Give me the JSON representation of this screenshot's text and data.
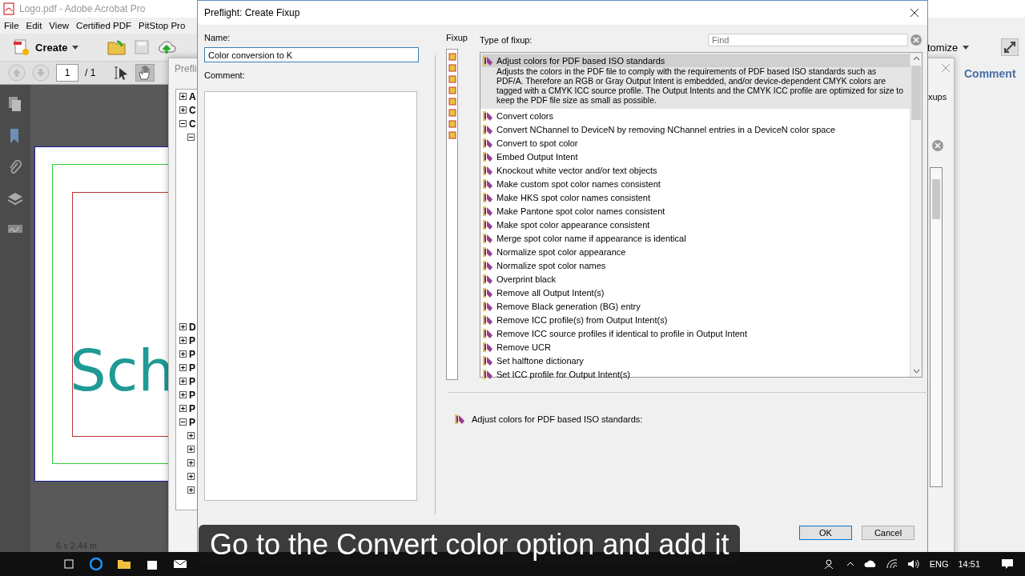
{
  "acrobat": {
    "title": "Logo.pdf - Adobe Acrobat Pro",
    "menu": [
      "File",
      "Edit",
      "View",
      "Certified PDF",
      "PitStop Pro"
    ],
    "create_button": "Create",
    "page_number": "1",
    "page_count": "/ 1",
    "document_text": "Sch",
    "customize_button": "tomize",
    "comment_tab": "Comment",
    "page_size": "6 x 2.44 in"
  },
  "preflight_window": {
    "title": "Prefli",
    "side_text": "xups",
    "tree": [
      {
        "label": "A",
        "expanded": false
      },
      {
        "label": "C",
        "expanded": false
      },
      {
        "label": "C",
        "expanded": true,
        "children": [
          {
            "expanded": true
          }
        ]
      },
      {
        "label": "D",
        "expanded": false
      },
      {
        "label": "P",
        "expanded": false
      },
      {
        "label": "P",
        "expanded": false
      },
      {
        "label": "P",
        "expanded": false
      },
      {
        "label": "P",
        "expanded": false
      },
      {
        "label": "P",
        "expanded": false
      },
      {
        "label": "P",
        "expanded": false
      },
      {
        "label": "P",
        "expanded": true,
        "children": [
          {
            "expanded": false
          },
          {
            "expanded": false
          },
          {
            "expanded": false
          },
          {
            "expanded": false
          },
          {
            "expanded": false
          }
        ]
      }
    ]
  },
  "dialog": {
    "title": "Preflight: Create Fixup",
    "name_label": "Name:",
    "name_value": "Color conversion to K",
    "comment_label": "Comment:",
    "fixup_label": "Fixup",
    "type_label": "Type of fixup:",
    "find_placeholder": "Find",
    "fixup_types": [
      {
        "label": "Adjust colors for PDF based ISO standards",
        "selected": true,
        "description": "Adjusts the colors in the PDF file to comply with the requirements of PDF based ISO standards such as PDF/A. Therefore an RGB or Gray Output Intent is embedded, and/or device-dependent CMYK colors are tagged with a CMYK ICC source profile. The Output Intents and the CMYK ICC profile are optimized for size to keep the PDF file size as small as possible."
      },
      {
        "label": "Convert colors",
        "selected": false
      },
      {
        "label": "Convert NChannel to DeviceN by removing NChannel entries in a DeviceN color space",
        "selected": false
      },
      {
        "label": "Convert to spot color",
        "selected": false
      },
      {
        "label": "Embed Output Intent",
        "selected": false
      },
      {
        "label": "Knockout white vector and/or text objects",
        "selected": false
      },
      {
        "label": "Make custom spot color names consistent",
        "selected": false
      },
      {
        "label": "Make HKS spot color names consistent",
        "selected": false
      },
      {
        "label": "Make Pantone spot color names consistent",
        "selected": false
      },
      {
        "label": "Make spot color appearance consistent",
        "selected": false
      },
      {
        "label": "Merge spot color name if appearance is identical",
        "selected": false
      },
      {
        "label": "Normalize spot color appearance",
        "selected": false
      },
      {
        "label": "Normalize spot color names",
        "selected": false
      },
      {
        "label": "Overprint black",
        "selected": false
      },
      {
        "label": "Remove all Output Intent(s)",
        "selected": false
      },
      {
        "label": "Remove Black generation (BG) entry",
        "selected": false
      },
      {
        "label": "Remove ICC profile(s) from Output Intent(s)",
        "selected": false
      },
      {
        "label": "Remove ICC source profiles if identical to profile in Output Intent",
        "selected": false
      },
      {
        "label": "Remove UCR",
        "selected": false
      },
      {
        "label": "Set halftone dictionary",
        "selected": false
      },
      {
        "label": "Set ICC profile for Output Intent(s)",
        "selected": false
      }
    ],
    "detail_title": "Adjust colors for PDF based ISO standards:",
    "buttons": [
      {
        "label": "OK",
        "default": true
      },
      {
        "label": "Cancel",
        "default": false
      }
    ]
  },
  "caption": "Go to the Convert color option and add it",
  "taskbar": {
    "language": "ENG",
    "time": "14:51"
  }
}
